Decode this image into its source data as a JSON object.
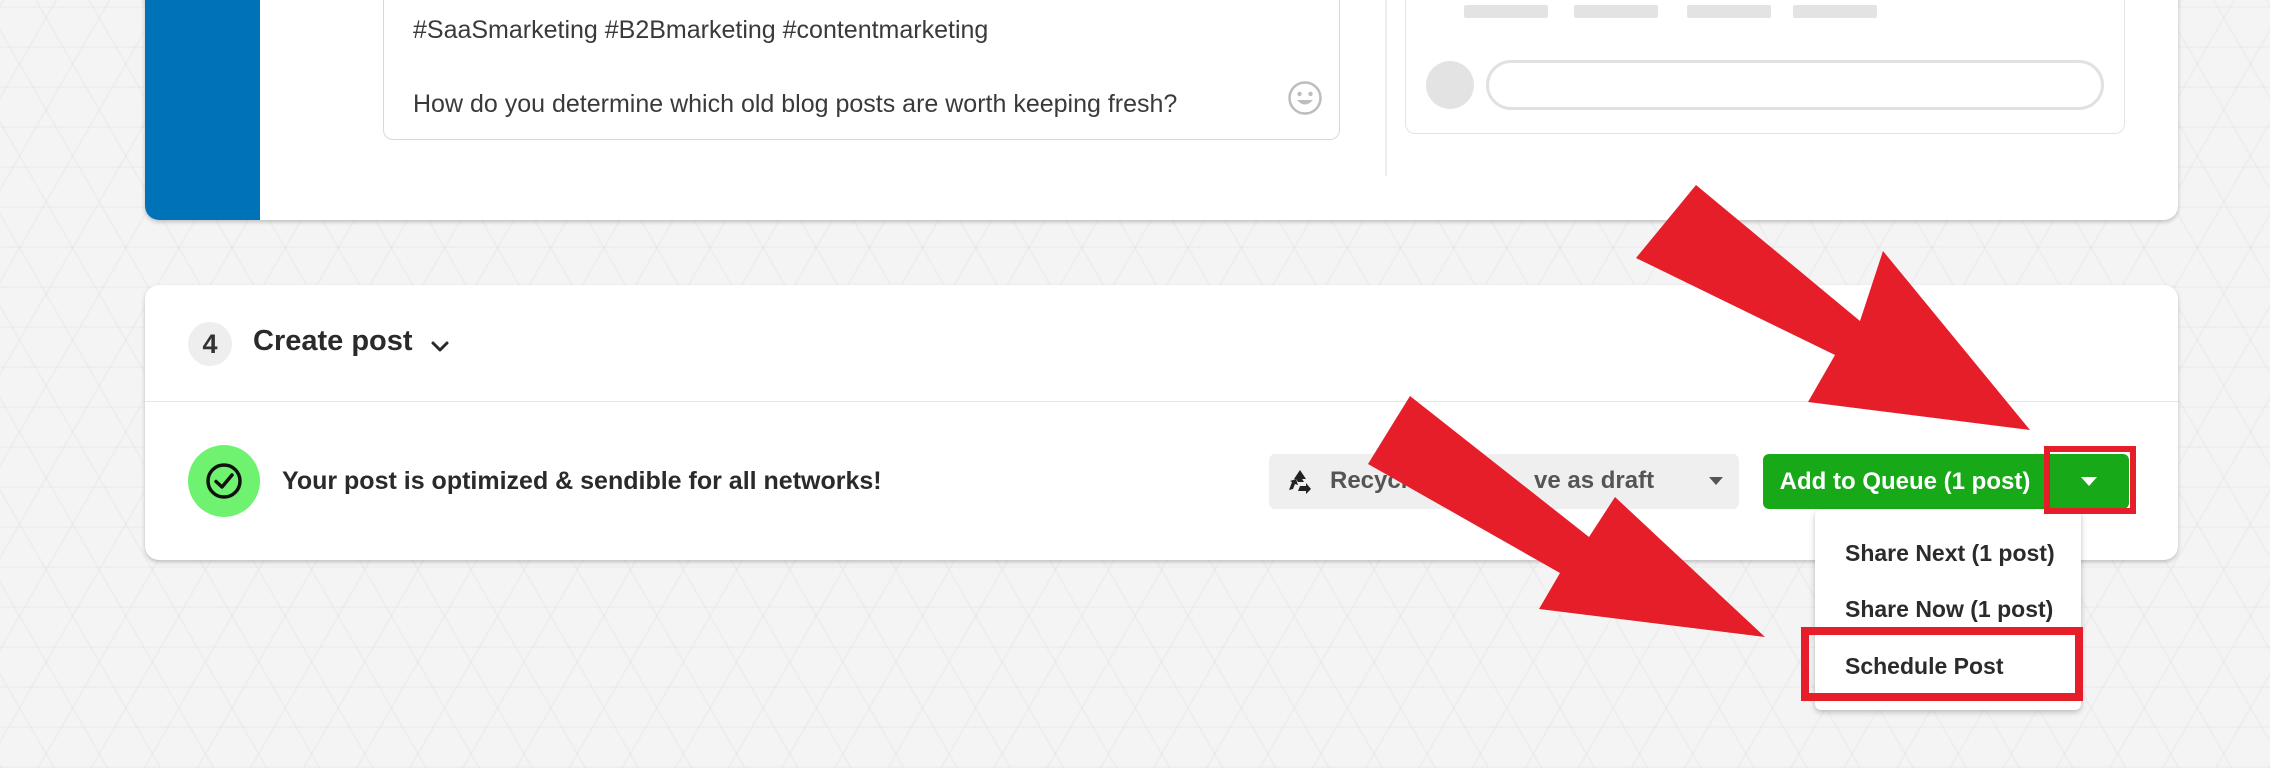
{
  "composer": {
    "caption_hashtags": "#SaaSmarketing #B2Bmarketing #contentmarketing",
    "caption_question": "How do you determine which old blog posts are worth keeping fresh?"
  },
  "create_post": {
    "step_number": "4",
    "title": "Create post",
    "status_message": "Your post is optimized & sendible for all networks!",
    "recycle_label": "Recycle",
    "save_draft_label": "ve as draft",
    "add_to_queue_label": "Add to Queue (1 post)",
    "menu": {
      "share_next": "Share Next (1 post)",
      "share_now": "Share Now (1 post)",
      "schedule_post": "Schedule Post"
    }
  },
  "colors": {
    "accent_blue": "#0072b8",
    "primary_green": "#18a918",
    "success_green": "#6ff26f",
    "annotation_red": "#e61e2a"
  }
}
